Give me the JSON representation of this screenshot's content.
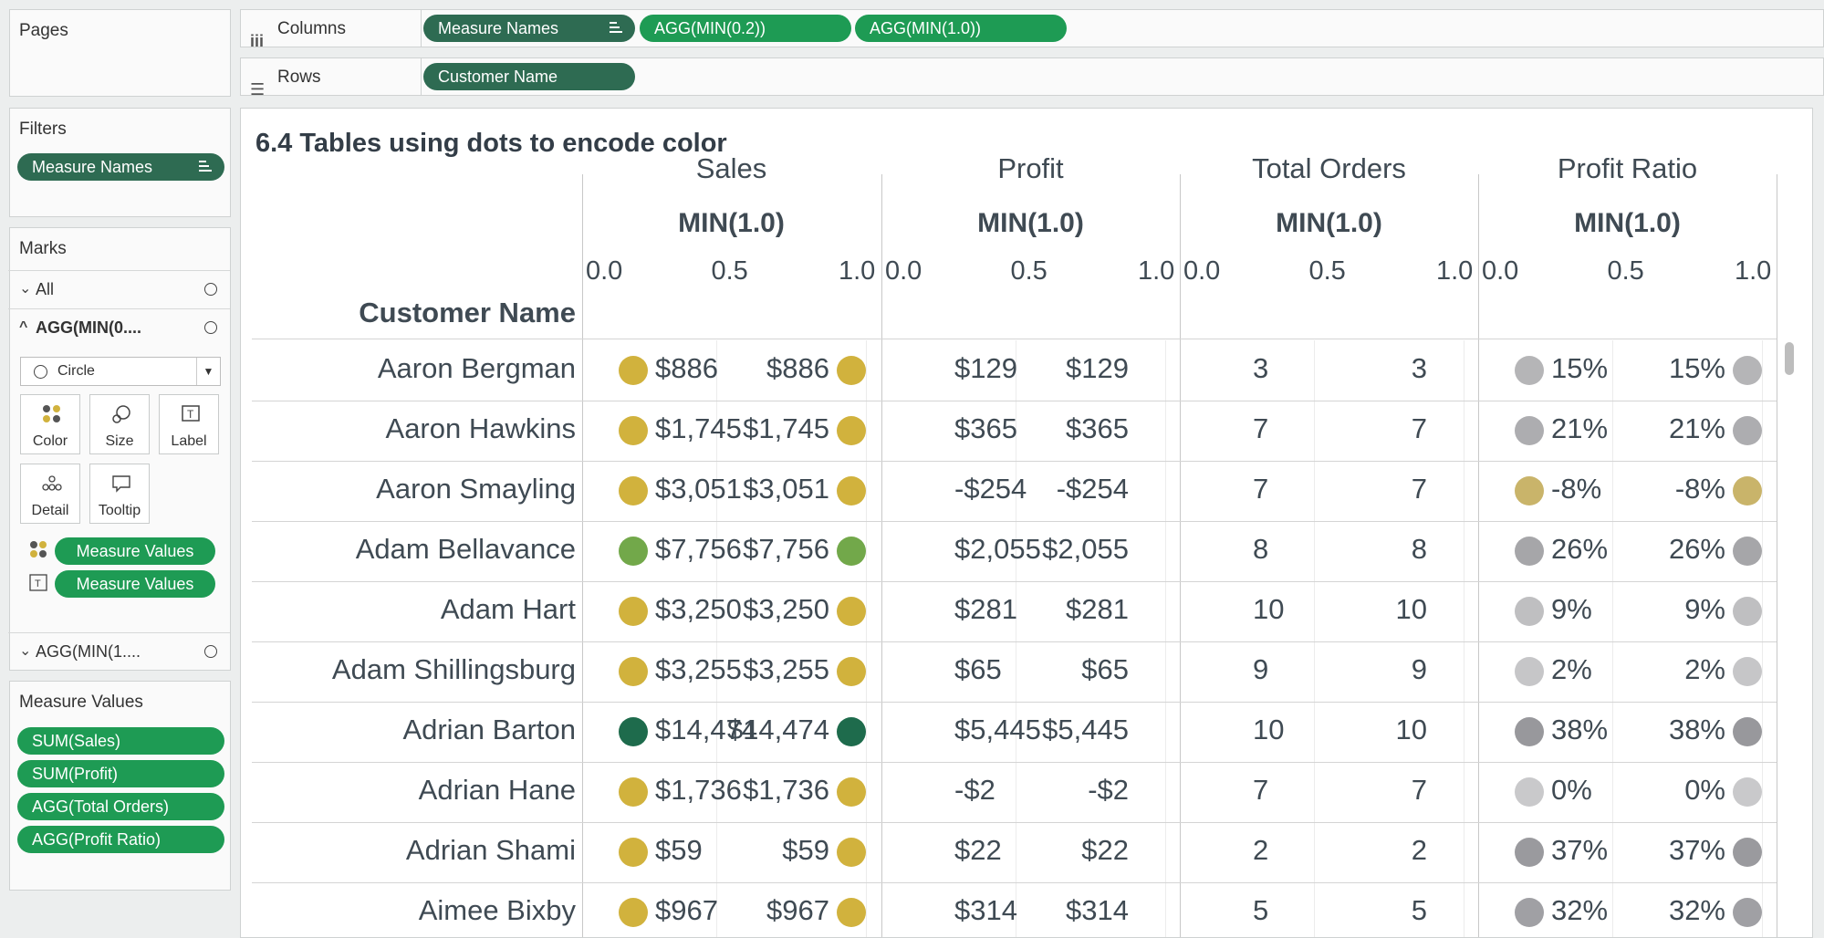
{
  "shelves": {
    "columns_label": "Columns",
    "rows_label": "Rows",
    "columns_pills": [
      "Measure Names",
      "AGG(MIN(0.2))",
      "AGG(MIN(1.0))"
    ],
    "rows_pills": [
      "Customer Name"
    ]
  },
  "pages": {
    "title": "Pages"
  },
  "filters": {
    "title": "Filters",
    "pill": "Measure Names"
  },
  "marks": {
    "title": "Marks",
    "all_label": "All",
    "agg1_label": "AGG(MIN(0....",
    "mark_type": "Circle",
    "buttons": [
      "Color",
      "Size",
      "Label",
      "Detail",
      "Tooltip"
    ],
    "color_pill": "Measure Values",
    "label_pill": "Measure Values",
    "agg2_label": "AGG(MIN(1...."
  },
  "measure_values": {
    "title": "Measure Values",
    "pills": [
      "SUM(Sales)",
      "SUM(Profit)",
      "AGG(Total Orders)",
      "AGG(Profit Ratio)"
    ]
  },
  "view": {
    "title": "6.4 Tables using dots to encode color",
    "row_header": "Customer Name",
    "columns": [
      {
        "name": "Sales",
        "sub": "MIN(1.0)"
      },
      {
        "name": "Profit",
        "sub": "MIN(1.0)"
      },
      {
        "name": "Total Orders",
        "sub": "MIN(1.0)"
      },
      {
        "name": "Profit Ratio",
        "sub": "MIN(1.0)"
      }
    ],
    "ticks": [
      "0.0",
      "0.5",
      "1.0"
    ],
    "rows": [
      {
        "name": "Aaron Bergman",
        "sales": "$886",
        "profit": "$129",
        "orders": "3",
        "ratio": "15%",
        "sales_color": "#d1b23d",
        "ratio_color": "#b5b5b7"
      },
      {
        "name": "Aaron Hawkins",
        "sales": "$1,745",
        "profit": "$365",
        "orders": "7",
        "ratio": "21%",
        "sales_color": "#d1b23d",
        "ratio_color": "#adadb0"
      },
      {
        "name": "Aaron Smayling",
        "sales": "$3,051",
        "profit": "-$254",
        "orders": "7",
        "ratio": "-8%",
        "sales_color": "#d1b23d",
        "ratio_color": "#c9b46a"
      },
      {
        "name": "Adam Bellavance",
        "sales": "$7,756",
        "profit": "$2,055",
        "orders": "8",
        "ratio": "26%",
        "sales_color": "#72a84a",
        "ratio_color": "#a6a6a9"
      },
      {
        "name": "Adam Hart",
        "sales": "$3,250",
        "profit": "$281",
        "orders": "10",
        "ratio": "9%",
        "sales_color": "#d1b23d",
        "ratio_color": "#bfbfc1"
      },
      {
        "name": "Adam Shillingsburg",
        "sales": "$3,255",
        "profit": "$65",
        "orders": "9",
        "ratio": "2%",
        "sales_color": "#d1b23d",
        "ratio_color": "#c6c6c8"
      },
      {
        "name": "Adrian Barton",
        "sales": "$14,474",
        "profit": "$5,445",
        "orders": "10",
        "ratio": "38%",
        "sales_color": "#1e6b4c",
        "ratio_color": "#98989c"
      },
      {
        "name": "Adrian Hane",
        "sales": "$1,736",
        "profit": "-$2",
        "orders": "7",
        "ratio": "0%",
        "sales_color": "#d1b23d",
        "ratio_color": "#c9c9cb"
      },
      {
        "name": "Adrian Shami",
        "sales": "$59",
        "profit": "$22",
        "orders": "2",
        "ratio": "37%",
        "sales_color": "#d1b23d",
        "ratio_color": "#9a9a9e"
      },
      {
        "name": "Aimee Bixby",
        "sales": "$967",
        "profit": "$314",
        "orders": "5",
        "ratio": "32%",
        "sales_color": "#d1b23d",
        "ratio_color": "#a0a0a4"
      }
    ]
  }
}
